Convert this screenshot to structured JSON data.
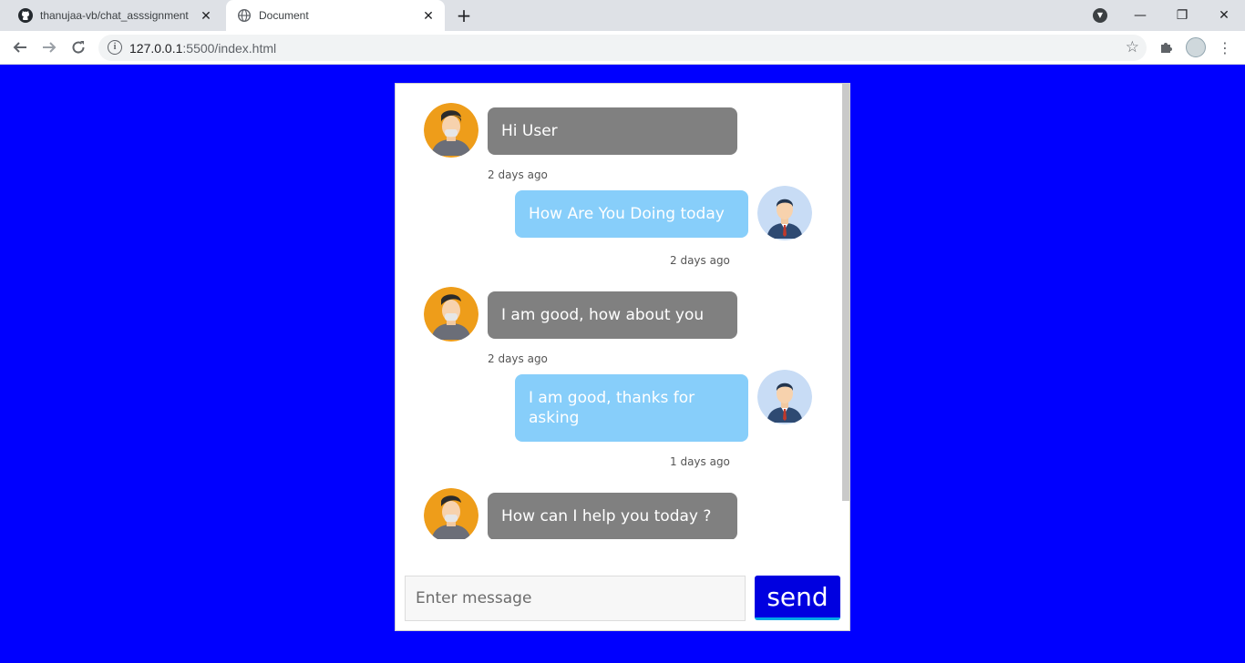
{
  "browser": {
    "tabs": [
      {
        "title": "thanujaa-vb/chat_asssignment",
        "icon": "github-icon",
        "active": false
      },
      {
        "title": "Document",
        "icon": "globe-icon",
        "active": true
      }
    ],
    "url_host": "127.0.0.1",
    "url_rest": ":5500/index.html",
    "colors": {
      "tabbar": "#dee1e6",
      "page_bg": "#0000ff"
    }
  },
  "chat": {
    "messages": [
      {
        "sender": "bot",
        "text": "Hi User",
        "time": "2 days ago"
      },
      {
        "sender": "user",
        "text": "How Are You Doing today",
        "time": "2 days ago"
      },
      {
        "sender": "bot",
        "text": "I am good, how about you",
        "time": "2 days ago"
      },
      {
        "sender": "user",
        "text": "I am good, thanks for asking",
        "time": "1 days ago"
      },
      {
        "sender": "bot",
        "text": "How can I help you today ?",
        "time": ""
      }
    ],
    "input_placeholder": "Enter message",
    "input_value": "",
    "send_label": "send",
    "colors": {
      "bot_bubble": "#808080",
      "user_bubble": "#87cefa",
      "send_button": "#0000e0"
    }
  }
}
